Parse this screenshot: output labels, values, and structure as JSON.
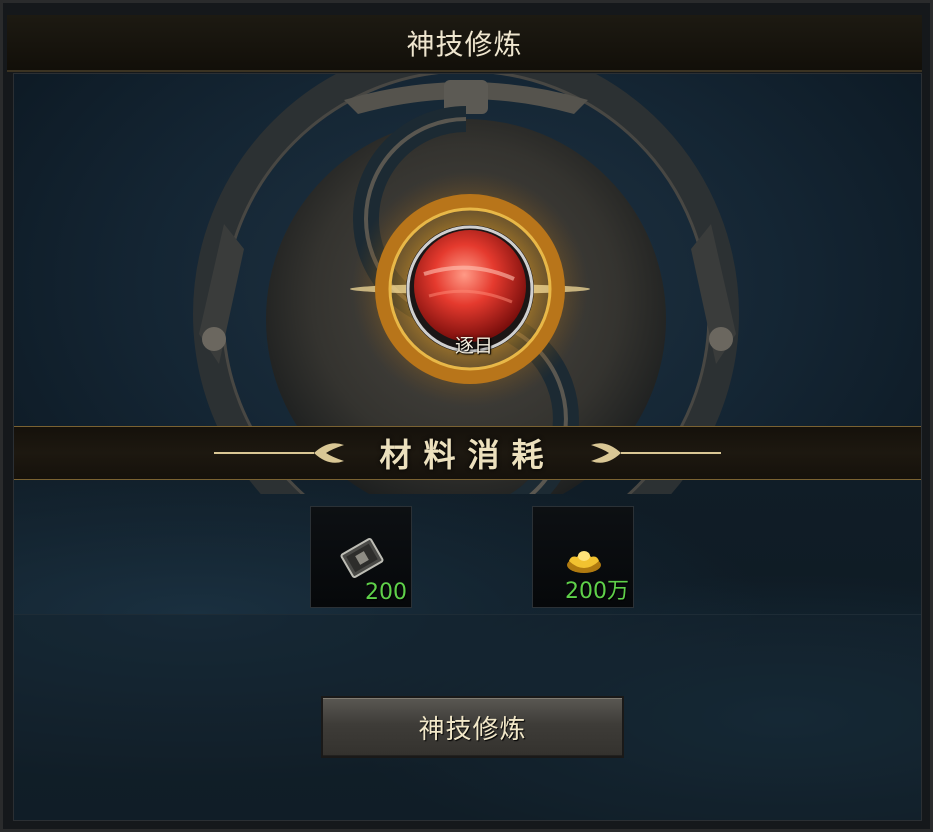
{
  "window": {
    "title": "神技修炼"
  },
  "skill": {
    "name": "逐日",
    "icon": "red-sun-orb-icon"
  },
  "materials": {
    "heading": "材料消耗",
    "items": [
      {
        "icon": "skill-book-icon",
        "quantity": "200"
      },
      {
        "icon": "gold-ingot-icon",
        "quantity": "200万"
      }
    ]
  },
  "actions": {
    "train_label": "神技修炼"
  },
  "colors": {
    "quantity_green": "#5fd14a",
    "gold_ring": "#d8a23a",
    "orb_red": "#e53a2e"
  }
}
